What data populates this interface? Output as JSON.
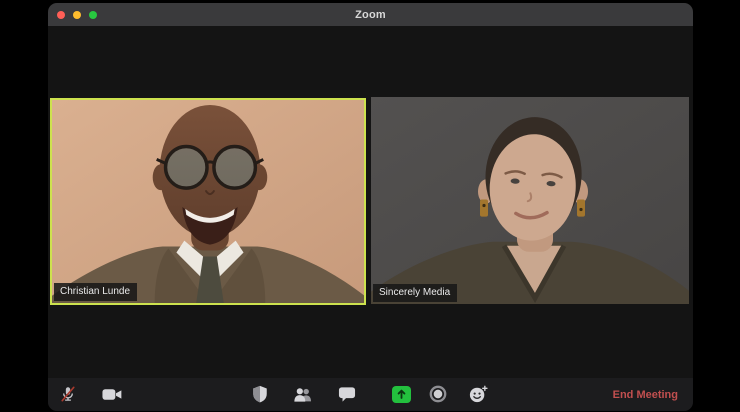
{
  "window": {
    "title": "Zoom"
  },
  "titlebar": {
    "traffic_lights": [
      "close",
      "minimize",
      "zoom-fullscreen"
    ]
  },
  "participants": [
    {
      "name": "Christian Lunde",
      "active_speaker": true
    },
    {
      "name": "Sincerely Media",
      "active_speaker": false
    }
  ],
  "toolbar": {
    "icons": [
      {
        "name": "microphone-muted-icon",
        "state": "muted"
      },
      {
        "name": "video-camera-icon",
        "state": "on"
      },
      {
        "name": "security-shield-icon"
      },
      {
        "name": "participants-icon"
      },
      {
        "name": "chat-bubble-icon"
      },
      {
        "name": "share-screen-icon"
      },
      {
        "name": "record-icon"
      },
      {
        "name": "reactions-icon"
      }
    ],
    "end_meeting_label": "End Meeting"
  },
  "colors": {
    "active_speaker_border": "#cde24e",
    "share_screen_green": "#23c03e",
    "end_meeting_red": "#c14f4f",
    "mute_slash_red": "#a93a2e",
    "titlebar_gray": "#3a3a3c",
    "toolbar_gray": "#1c1c1e",
    "traffic_red": "#ff5f57",
    "traffic_yellow": "#febc2e",
    "traffic_green": "#28c840"
  }
}
